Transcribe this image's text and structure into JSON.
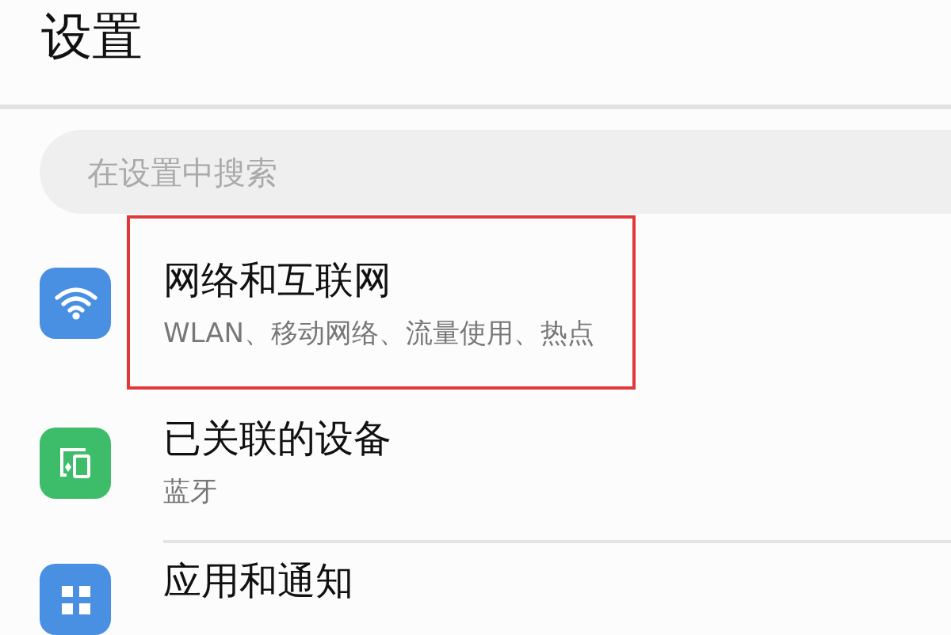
{
  "header": {
    "title": "设置"
  },
  "search": {
    "placeholder": "在设置中搜索"
  },
  "rows": [
    {
      "kind": "wifi",
      "color": "#4a90e2",
      "title": "网络和互联网",
      "subtitle": "WLAN、移动网络、流量使用、热点",
      "highlighted": true
    },
    {
      "kind": "devices",
      "color": "#3dbd6a",
      "title": "已关联的设备",
      "subtitle": "蓝牙",
      "highlighted": false
    },
    {
      "kind": "apps",
      "color": "#4a90e2",
      "title": "应用和通知",
      "highlighted": false
    }
  ]
}
